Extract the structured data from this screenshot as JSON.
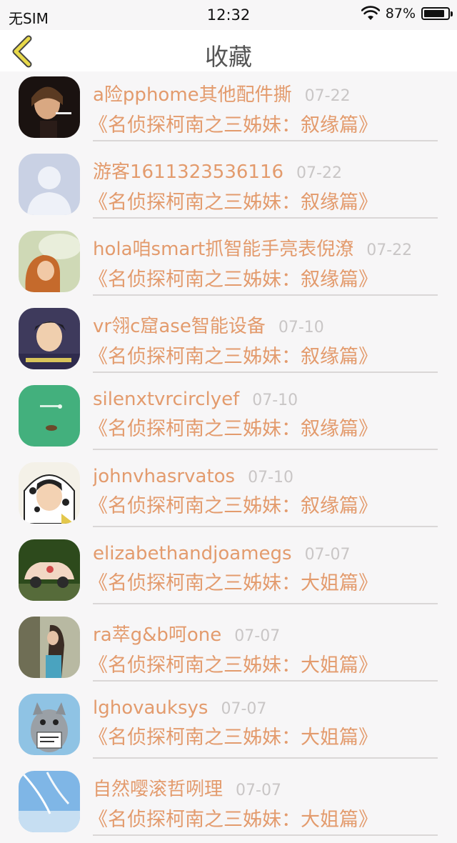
{
  "status_bar": {
    "carrier": "无SIM",
    "time": "12:32",
    "battery_percent": "87%",
    "battery_level": 0.87
  },
  "nav": {
    "title": "收藏",
    "back_icon": "chevron-left-icon",
    "accent_color": "#e8d94a"
  },
  "colors": {
    "username": "#e39b6d",
    "date": "#c9c6c6",
    "divider": "#dad7d7",
    "background": "#f7f6f7"
  },
  "items": [
    {
      "user": "a险pphome其他配件撕",
      "date": "07-22",
      "title": "《名侦探柯南之三姊妹：叙缘篇》",
      "avatar": "avatar-dark-portrait"
    },
    {
      "user": "游客1611323536116",
      "date": "07-22",
      "title": "《名侦探柯南之三姊妹：叙缘篇》",
      "avatar": "avatar-default-silhouette"
    },
    {
      "user": "hola咱smart抓智能手亮表倪潦",
      "date": "07-22",
      "title": "《名侦探柯南之三姊妹：叙缘篇》",
      "avatar": "avatar-girl-umbrella"
    },
    {
      "user": "vr翎c窟ase智能设备",
      "date": "07-10",
      "title": "《名侦探柯南之三姊妹：叙缘篇》",
      "avatar": "avatar-boy-portrait"
    },
    {
      "user": "silenxtvrcirclyef",
      "date": "07-10",
      "title": "《名侦探柯南之三姊妹：叙缘篇》",
      "avatar": "avatar-green"
    },
    {
      "user": "johnvhasrvatos",
      "date": "07-10",
      "title": "《名侦探柯南之三姊妹：叙缘篇》",
      "avatar": "avatar-anime-hoodie"
    },
    {
      "user": "elizabethandjoamegs",
      "date": "07-07",
      "title": "《名侦探柯南之三姊妹：大姐篇》",
      "avatar": "avatar-toy-car"
    },
    {
      "user": "ra萃g&b呵one",
      "date": "07-07",
      "title": "《名侦探柯南之三姊妹：大姐篇》",
      "avatar": "avatar-woman-outdoor"
    },
    {
      "user": "lghovauksys",
      "date": "07-07",
      "title": "《名侦探柯南之三姊妹：大姐篇》",
      "avatar": "avatar-cat-sign"
    },
    {
      "user": "自然嘤滚哲咧理",
      "date": "07-07",
      "title": "《名侦探柯南之三姊妹：大姐篇》",
      "avatar": "avatar-blue-sky"
    }
  ]
}
